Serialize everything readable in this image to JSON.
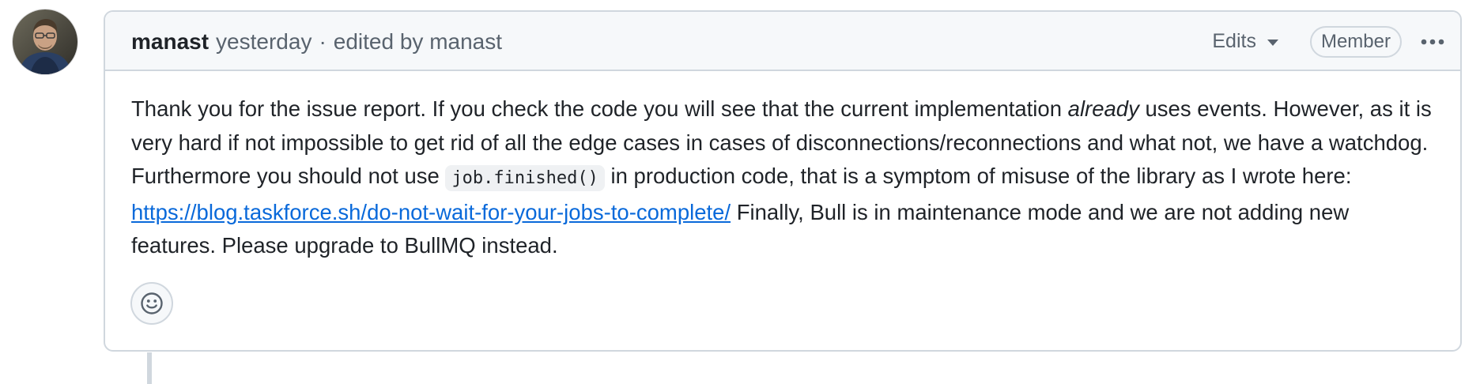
{
  "comment": {
    "author": "manast",
    "timestamp": "yesterday",
    "separator": "·",
    "edited_by": "edited by manast",
    "edits_label": "Edits",
    "role_badge": "Member",
    "menu_icon": "kebab-horizontal-icon",
    "avatar_icon": "user-avatar",
    "body": {
      "p1": "Thank you for the issue report. If you check the code you will see that the current implementation ",
      "emph": "already",
      "p2": " uses events. However, as it is very hard if not impossible to get rid of all the edge cases in cases of disconnections/reconnections and what not, we have a watchdog. Furthermore you should not use ",
      "code": "job.finished()",
      "p3": " in production code, that is a symptom of misuse of the library as I wrote here: ",
      "link": "https://blog.taskforce.sh/do-not-wait-for-your-jobs-to-complete/",
      "p4": " Finally, Bull is in maintenance mode and we are not adding new features. Please upgrade to BullMQ instead."
    },
    "reaction_icon": "smiley-icon"
  },
  "colors": {
    "border": "#d0d7de",
    "header_bg": "#f6f8fa",
    "muted_text": "#59636e",
    "link": "#0969da"
  }
}
